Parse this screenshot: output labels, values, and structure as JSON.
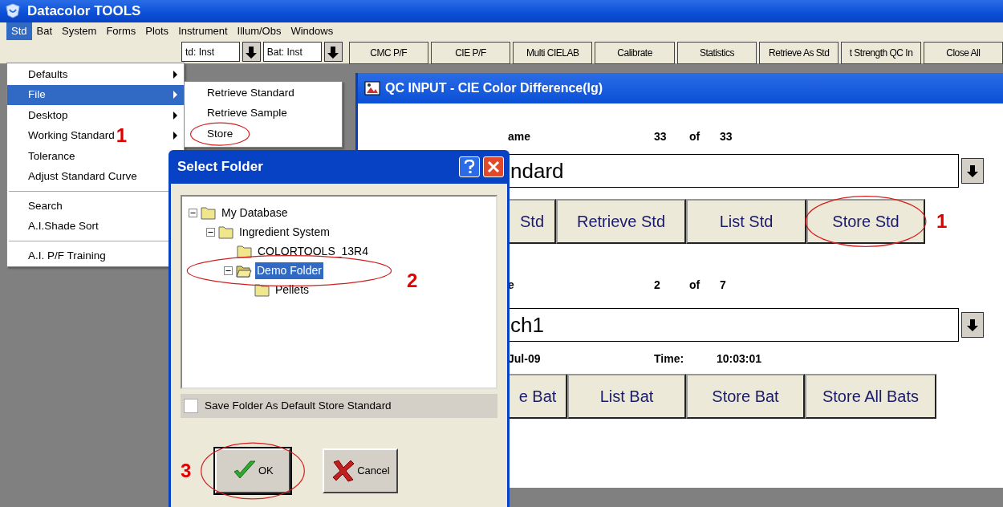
{
  "window": {
    "title": "Datacolor TOOLS"
  },
  "menu_bar": [
    {
      "label": "Std",
      "selected": true
    },
    {
      "label": "Bat",
      "selected": false
    },
    {
      "label": "System",
      "selected": false
    },
    {
      "label": "Forms",
      "selected": false
    },
    {
      "label": "Plots",
      "selected": false
    },
    {
      "label": "Instrument",
      "selected": false
    },
    {
      "label": "Illum/Obs",
      "selected": false
    },
    {
      "label": "Windows",
      "selected": false
    }
  ],
  "toolbar": {
    "combos": [
      "td: Inst",
      "Bat: Inst"
    ],
    "buttons": [
      "CMC P/F",
      "CIE P/F",
      "Multi CIELAB",
      "Calibrate",
      "Statistics",
      "Retrieve As Std",
      "t Strength QC In",
      "Close All"
    ]
  },
  "std_menu": [
    {
      "kind": "item",
      "label": "Defaults",
      "submenu": true,
      "selected": false
    },
    {
      "kind": "item",
      "label": "File",
      "submenu": true,
      "selected": true
    },
    {
      "kind": "item",
      "label": "Desktop",
      "submenu": true,
      "selected": false
    },
    {
      "kind": "item",
      "label": "Working Standard",
      "submenu": true,
      "selected": false,
      "annotation": "1"
    },
    {
      "kind": "item",
      "label": "Tolerance",
      "submenu": false,
      "selected": false
    },
    {
      "kind": "item",
      "label": "Adjust Standard Curve",
      "submenu": false,
      "selected": false
    },
    {
      "kind": "separator"
    },
    {
      "kind": "item",
      "label": "Search",
      "submenu": false,
      "selected": false
    },
    {
      "kind": "item",
      "label": "A.I.Shade Sort",
      "submenu": false,
      "selected": false
    },
    {
      "kind": "separator"
    },
    {
      "kind": "item",
      "label": "A.I. P/F Training",
      "submenu": false,
      "selected": false
    }
  ],
  "file_submenu": [
    {
      "label": "Retrieve Standard",
      "circled": false
    },
    {
      "label": "Retrieve Sample",
      "circled": false
    },
    {
      "label": "Store",
      "circled": true
    }
  ],
  "qc_window": {
    "title": "QC INPUT - CIE Color Difference(lg)",
    "standard": {
      "label": "ame",
      "index": "33",
      "of": "of",
      "total": "33",
      "value": "ndard",
      "buttons": [
        {
          "label": "Std",
          "circled": false
        },
        {
          "label": "Retrieve Std",
          "circled": false
        },
        {
          "label": "List Std",
          "circled": false
        },
        {
          "label": "Store Std",
          "circled": true,
          "annotation": "1"
        }
      ]
    },
    "batch": {
      "label": "e",
      "index": "2",
      "of": "of",
      "total": "7",
      "value": "ch1",
      "date": "Jul-09",
      "time_label": "Time:",
      "time": "10:03:01",
      "buttons": [
        {
          "label": "e Bat",
          "circled": false
        },
        {
          "label": "List Bat",
          "circled": false
        },
        {
          "label": "Store Bat",
          "circled": false
        },
        {
          "label": "Store All Bats",
          "circled": false
        }
      ]
    }
  },
  "dialog": {
    "title": "Select Folder",
    "tree": [
      {
        "label": "My Database",
        "expanded": true,
        "selected": false,
        "children": [
          {
            "label": "Ingredient System",
            "expanded": true,
            "selected": false,
            "children": [
              {
                "label": "COLORTOOLS_13R4",
                "selected": false
              },
              {
                "label": "Demo Folder",
                "expanded": true,
                "selected": true,
                "circled": true,
                "annotation": "2",
                "children": [
                  {
                    "label": "Pellets",
                    "selected": false
                  }
                ]
              }
            ]
          }
        ]
      }
    ],
    "checkbox": {
      "label": "Save Folder As Default Store Standard",
      "checked": false
    },
    "buttons": [
      {
        "kind": "ok",
        "label": "OK",
        "default": true,
        "circled": true,
        "annotation": "3"
      },
      {
        "kind": "cancel",
        "label": "Cancel",
        "default": false,
        "circled": false
      }
    ]
  }
}
